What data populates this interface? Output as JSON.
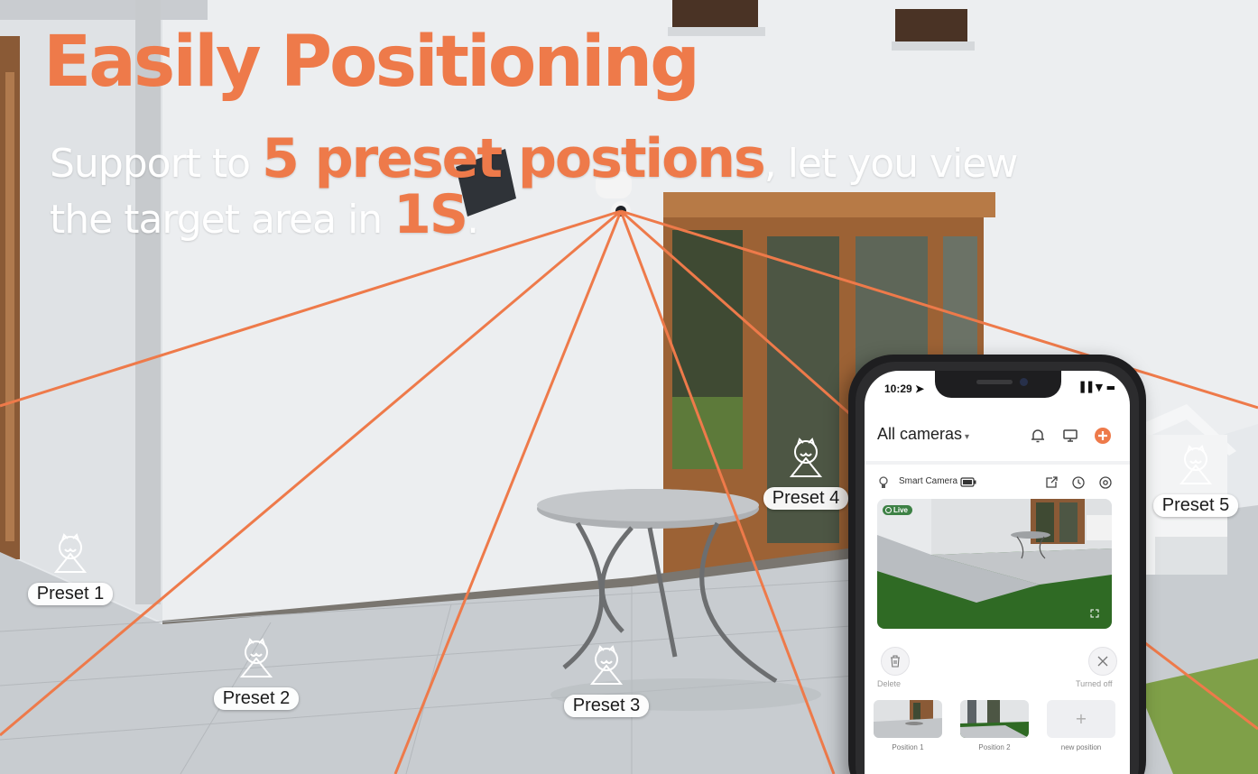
{
  "headline": "Easily  Positioning",
  "subline1": {
    "pre": "Support to ",
    "emph": "5 preset postions",
    "post": ", let you view"
  },
  "subline2": {
    "pre": "the target area in ",
    "emph": "1S",
    "post": "."
  },
  "colors": {
    "accent": "#ee7a4a",
    "subtext": "#ffffff",
    "laser": "#ee7a4a"
  },
  "presets": [
    {
      "label": "Preset 1",
      "icon": "map-pin-icon"
    },
    {
      "label": "Preset 2",
      "icon": "map-pin-icon"
    },
    {
      "label": "Preset 3",
      "icon": "map-pin-icon"
    },
    {
      "label": "Preset 4",
      "icon": "map-pin-icon"
    },
    {
      "label": "Preset 5",
      "icon": "map-pin-icon"
    }
  ],
  "phone": {
    "status_time": "10:29",
    "title": "All cameras",
    "camera_name": "Smart Camera",
    "live_badge": "Live",
    "delete_label": "Delete",
    "turned_off_label": "Turned off",
    "positions": [
      {
        "label": "Position 1"
      },
      {
        "label": "Position 2"
      },
      {
        "label": "new position"
      }
    ],
    "icons": [
      "bell-icon",
      "screen-icon",
      "add-icon",
      "battery-icon",
      "share-icon",
      "clock-icon",
      "settings-icon",
      "trash-icon",
      "close-icon",
      "fullscreen-icon"
    ]
  }
}
